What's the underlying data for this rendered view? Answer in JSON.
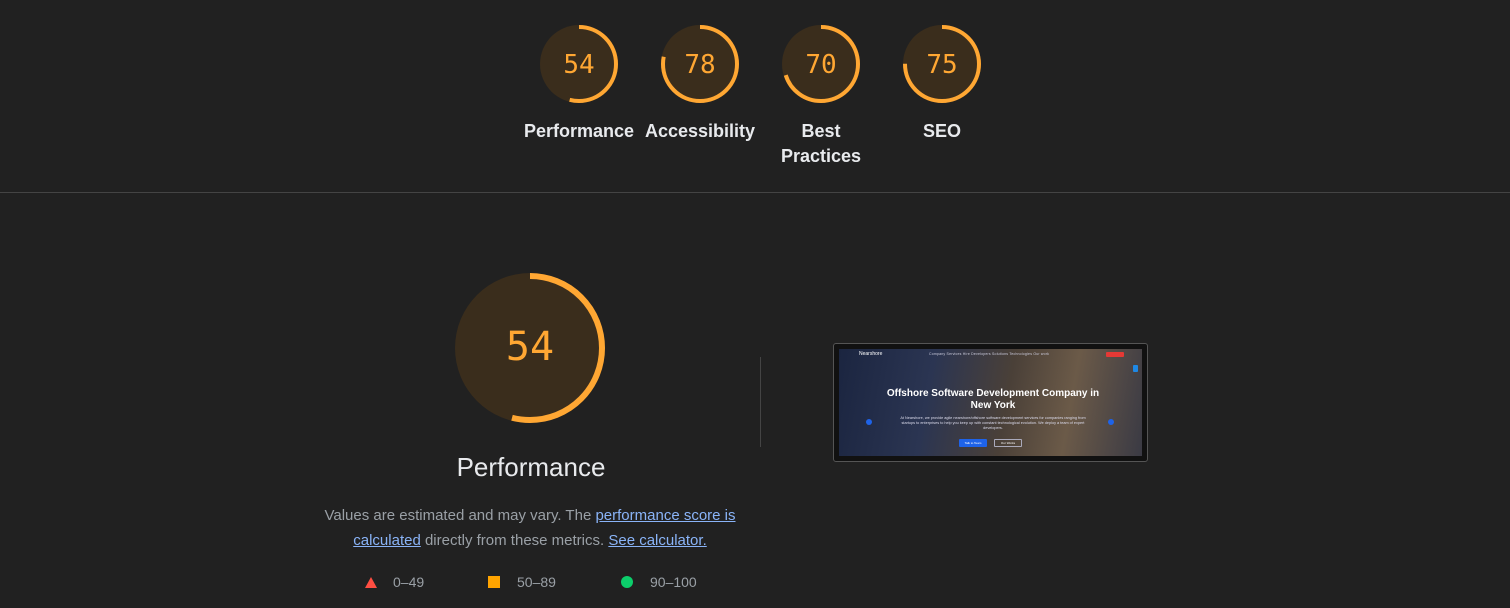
{
  "categories": [
    {
      "label": "Performance",
      "score": 54
    },
    {
      "label": "Accessibility",
      "score": 78
    },
    {
      "label": "Best Practices",
      "score": 70
    },
    {
      "label": "SEO",
      "score": 75
    }
  ],
  "performance": {
    "score": "54",
    "score_value": 54,
    "title": "Performance",
    "desc_prefix": "Values are estimated and may vary. The ",
    "link1": "performance score is calculated",
    "desc_middle": " directly from these metrics. ",
    "link2": "See calculator."
  },
  "legend": [
    {
      "range": "0–49",
      "shape": "triangle",
      "color": "#ff4e42"
    },
    {
      "range": "50–89",
      "shape": "square",
      "color": "#ffa400"
    },
    {
      "range": "90–100",
      "shape": "circle",
      "color": "#0cce6b"
    }
  ],
  "screenshot": {
    "logo": "Nearshore",
    "nav": "Company   Services   Hire Developers   Solutions   Technologies   Our work",
    "heading": "Offshore Software Development Company in New York",
    "paragraph": "At Nearshore, we provide agile nearshore/offshore software development services for companies ranging from startups to enterprises to help you keep up with constant technological evolution. We deploy a team of expert developers.",
    "button_primary": "Talk to Team",
    "button_secondary": "Our Works"
  },
  "colors": {
    "score_average": "#ffa733",
    "ring_bg": "#3a2d1c",
    "page_bg": "#212121"
  }
}
